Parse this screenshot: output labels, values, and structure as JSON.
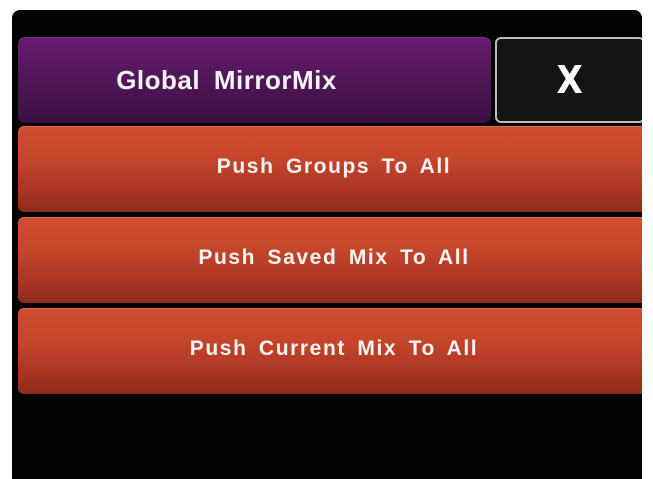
{
  "header": {
    "title": "Global  MirrorMix",
    "close_label": "X"
  },
  "actions": [
    {
      "label": "Push Groups To All"
    },
    {
      "label": "Push Saved Mix To All"
    },
    {
      "label": "Push Current Mix To All"
    }
  ],
  "colors": {
    "title_bar": "#521659",
    "action_button": "#c4452a",
    "background": "#020202",
    "close_border": "#bdbdbd"
  }
}
